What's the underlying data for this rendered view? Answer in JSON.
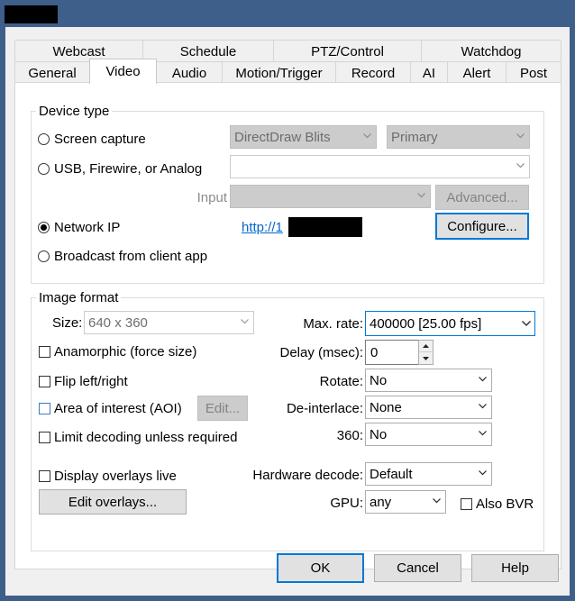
{
  "window": {
    "title_redacted": true
  },
  "tabs_row1": [
    "Webcast",
    "Schedule",
    "PTZ/Control",
    "Watchdog"
  ],
  "tabs_row2": [
    "General",
    "Video",
    "Audio",
    "Motion/Trigger",
    "Record",
    "AI",
    "Alert",
    "Post"
  ],
  "active_tab": "Video",
  "device_type": {
    "legend": "Device type",
    "screen_capture_label": "Screen capture",
    "capture_method": "DirectDraw Blits",
    "monitor": "Primary",
    "usb_label": "USB, Firewire, or Analog",
    "usb_device": "",
    "input_label": "Input",
    "input_value": "",
    "advanced_label": "Advanced...",
    "network_ip_label": "Network IP",
    "network_url": "http://1",
    "configure_label": "Configure...",
    "broadcast_label": "Broadcast from client app",
    "selected": "Network IP"
  },
  "image_format": {
    "legend": "Image format",
    "size_label": "Size:",
    "size_value": "640 x 360",
    "max_rate_label": "Max. rate:",
    "max_rate_value": "400000 [25.00 fps]",
    "anamorphic_label": "Anamorphic (force size)",
    "delay_label": "Delay (msec):",
    "delay_value": "0",
    "flip_label": "Flip left/right",
    "rotate_label": "Rotate:",
    "rotate_value": "No",
    "aoi_label": "Area of interest (AOI)",
    "aoi_edit_label": "Edit...",
    "deinterlace_label": "De-interlace:",
    "deinterlace_value": "None",
    "limit_decoding_label": "Limit decoding unless required",
    "label_360": "360:",
    "value_360": "No",
    "display_overlays_label": "Display overlays live",
    "hw_decode_label": "Hardware decode:",
    "hw_decode_value": "Default",
    "edit_overlays_label": "Edit overlays...",
    "gpu_label": "GPU:",
    "gpu_value": "any",
    "also_bvr_label": "Also BVR"
  },
  "footer": {
    "ok": "OK",
    "cancel": "Cancel",
    "help": "Help"
  }
}
